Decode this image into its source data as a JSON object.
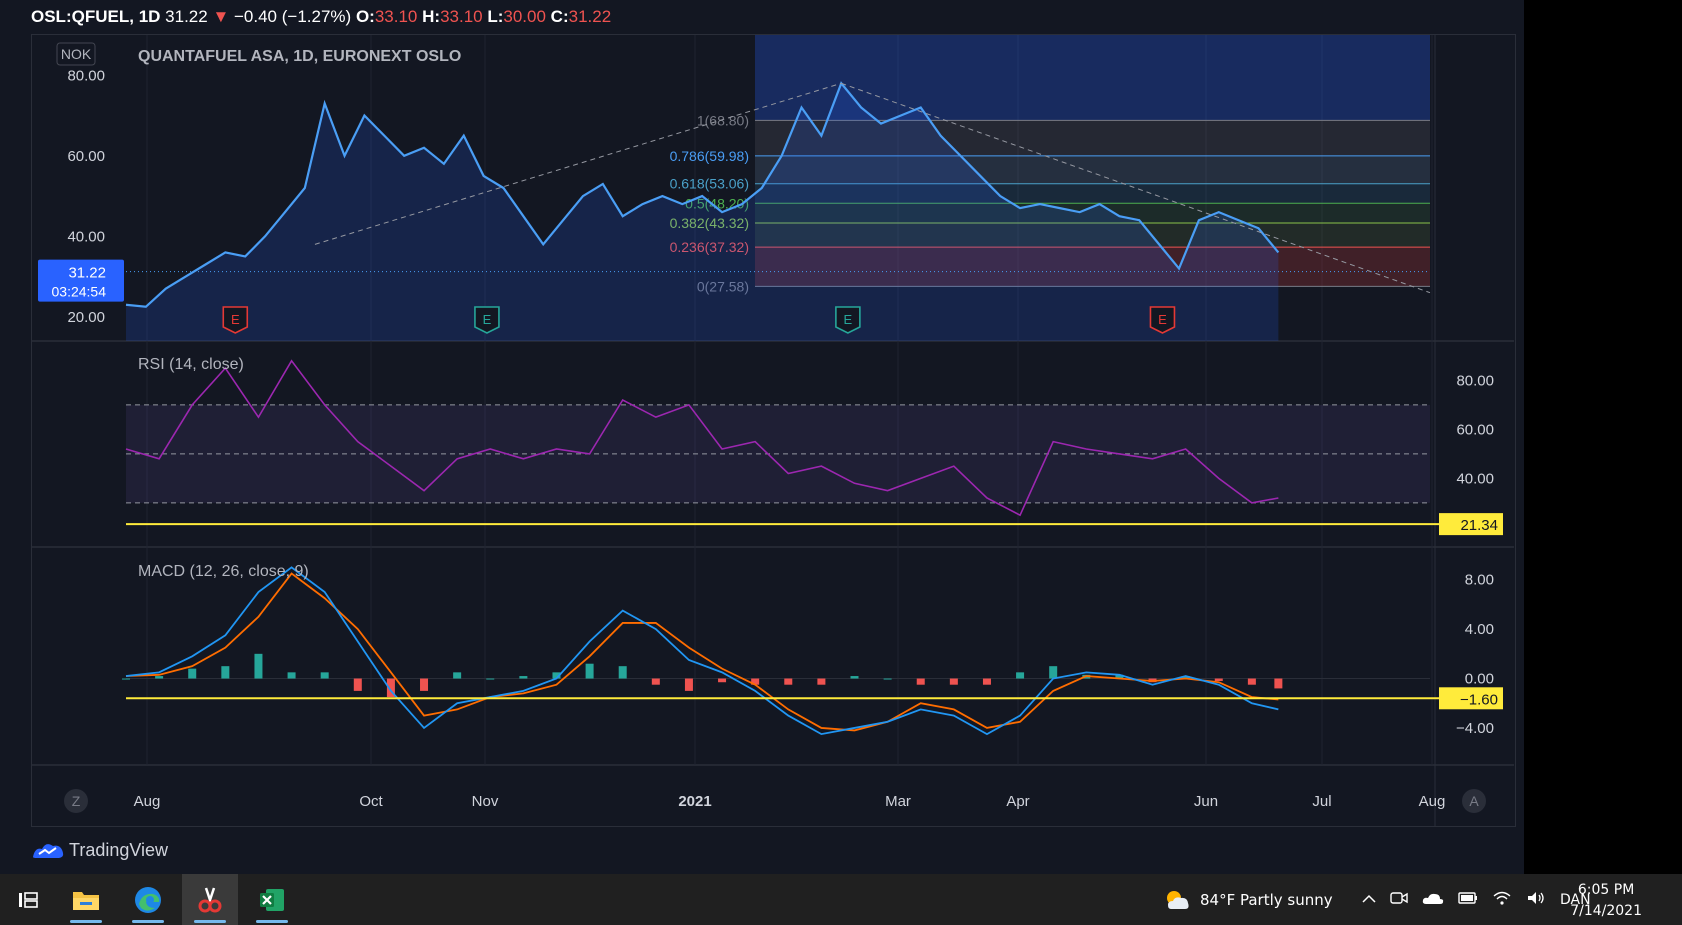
{
  "header": {
    "symbol": "OSL:QFUEL,",
    "interval": "1D",
    "last": "31.22",
    "change_arrow": "▼",
    "change": "−0.40 (−1.27%)",
    "open_label": "O:",
    "open": "33.10",
    "high_label": "H:",
    "high": "33.10",
    "low_label": "L:",
    "low": "30.00",
    "close_label": "C:",
    "close": "31.22"
  },
  "price_pane": {
    "currency": "NOK",
    "title": "QUANTAFUEL ASA, 1D, EURONEXT OSLO",
    "price_tag": "31.22",
    "countdown": "03:24:54"
  },
  "rsi_pane": {
    "title": "RSI (14, close)",
    "marker_label": "21.34"
  },
  "macd_pane": {
    "title": "MACD (12, 26, close, 9)",
    "marker_label": "−1.60"
  },
  "buttons": {
    "left": "Z",
    "right": "A"
  },
  "brand": {
    "name": "TradingView"
  },
  "taskbar": {
    "weather": "84°F  Partly sunny",
    "language": "DAN",
    "time": "6:05 PM",
    "date": "7/14/2021"
  },
  "colors": {
    "price_line": "#4a9ef5",
    "rsi_line": "#9c27b0",
    "macd_line": "#2196f3",
    "signal_line": "#ff6d00",
    "hist_up": "#26a69a",
    "hist_down": "#ef5350",
    "marker": "#ffeb3b",
    "earnings_red": "#e53935",
    "earnings_green": "#26a69a"
  },
  "chart_data": [
    {
      "type": "line",
      "name": "price",
      "x_ticks": [
        "Aug",
        "Oct",
        "Nov",
        "2021",
        "Mar",
        "Apr",
        "Jun",
        "Jul",
        "Aug"
      ],
      "y_ticks": [
        "20.00",
        "40.00",
        "60.00",
        "80.00"
      ],
      "ylim": [
        14,
        90
      ],
      "x": [
        0,
        6,
        12,
        18,
        24,
        30,
        36,
        42,
        48,
        54,
        60,
        66,
        72,
        78,
        84,
        90,
        96,
        102,
        108,
        114,
        120,
        126,
        132,
        138,
        144,
        150,
        156,
        162,
        168,
        174,
        180,
        186,
        192,
        198,
        204,
        210,
        216,
        222,
        228,
        234,
        240,
        246,
        252,
        258,
        264,
        270,
        276,
        282,
        288,
        294,
        300,
        306,
        312,
        318,
        324,
        330,
        336,
        342,
        348
      ],
      "values": [
        23,
        22.5,
        27,
        30,
        33,
        36,
        35,
        40,
        46,
        52,
        73,
        60,
        70,
        65,
        60,
        62,
        58,
        65,
        55,
        52,
        45,
        38,
        44,
        50,
        53,
        45,
        48,
        50,
        48,
        50,
        46,
        48,
        52,
        60,
        72,
        65,
        78,
        72,
        68,
        70,
        72,
        65,
        60,
        55,
        50,
        47,
        48,
        47,
        46,
        48,
        45,
        44,
        38,
        32,
        44,
        46,
        44,
        42,
        36
      ],
      "annotations": {
        "earnings": [
          {
            "x": 33,
            "label": "E",
            "color": "red"
          },
          {
            "x": 109,
            "label": "E",
            "color": "green"
          },
          {
            "x": 218,
            "label": "E",
            "color": "green"
          },
          {
            "x": 313,
            "label": "E",
            "color": "red"
          }
        ],
        "fibonacci": [
          {
            "label": "1(68.80)",
            "value": 68.8
          },
          {
            "label": "0.786(59.98)",
            "value": 59.98
          },
          {
            "label": "0.618(53.06)",
            "value": 53.06
          },
          {
            "label": "0.5(48.20)",
            "value": 48.2
          },
          {
            "label": "0.382(43.32)",
            "value": 43.32
          },
          {
            "label": "0.236(37.32)",
            "value": 37.32
          },
          {
            "label": "0(27.58)",
            "value": 27.58
          }
        ]
      }
    },
    {
      "type": "line",
      "name": "RSI",
      "y_ticks": [
        "40.00",
        "60.00",
        "80.00"
      ],
      "bands": [
        30,
        50,
        70
      ],
      "ylim": [
        12,
        92
      ],
      "x": [
        0,
        10,
        20,
        30,
        40,
        50,
        60,
        70,
        80,
        90,
        100,
        110,
        120,
        130,
        140,
        150,
        160,
        170,
        180,
        190,
        200,
        210,
        220,
        230,
        240,
        250,
        260,
        270,
        280,
        290,
        300,
        310,
        320,
        330,
        340,
        348
      ],
      "values": [
        52,
        48,
        70,
        85,
        65,
        88,
        70,
        55,
        45,
        35,
        48,
        52,
        48,
        52,
        50,
        72,
        65,
        70,
        52,
        55,
        42,
        45,
        38,
        35,
        40,
        45,
        32,
        25,
        55,
        52,
        50,
        48,
        52,
        40,
        30,
        32
      ],
      "marker_value": 21.34
    },
    {
      "type": "line",
      "name": "MACD",
      "y_ticks": [
        "−4.00",
        "0.00",
        "4.00",
        "8.00"
      ],
      "ylim": [
        -7,
        10
      ],
      "x": [
        0,
        10,
        20,
        30,
        40,
        50,
        60,
        70,
        80,
        90,
        100,
        110,
        120,
        130,
        140,
        150,
        160,
        170,
        180,
        190,
        200,
        210,
        220,
        230,
        240,
        250,
        260,
        270,
        280,
        290,
        300,
        310,
        320,
        330,
        340,
        348
      ],
      "series": [
        {
          "name": "MACD",
          "values": [
            0.2,
            0.5,
            1.8,
            3.5,
            7.0,
            9.0,
            7.0,
            3.0,
            -1.0,
            -4.0,
            -2.0,
            -1.5,
            -1.0,
            0.0,
            3.0,
            5.5,
            4.0,
            1.5,
            0.5,
            -1.0,
            -3.0,
            -4.5,
            -4.0,
            -3.5,
            -2.5,
            -3.0,
            -4.5,
            -3.0,
            0.0,
            0.5,
            0.3,
            -0.5,
            0.2,
            -0.5,
            -2.0,
            -2.5
          ]
        },
        {
          "name": "Signal",
          "values": [
            0.2,
            0.3,
            1.0,
            2.5,
            5.0,
            8.5,
            6.5,
            4.0,
            0.5,
            -3.0,
            -2.5,
            -1.5,
            -1.2,
            -0.5,
            1.8,
            4.5,
            4.5,
            2.5,
            0.8,
            -0.5,
            -2.5,
            -4.0,
            -4.2,
            -3.5,
            -2.0,
            -2.5,
            -4.0,
            -3.5,
            -1.0,
            0.2,
            0.0,
            -0.2,
            0.0,
            -0.3,
            -1.5,
            -1.7
          ]
        }
      ],
      "histogram": [
        0.0,
        0.2,
        0.8,
        1.0,
        2.0,
        0.5,
        0.5,
        -1.0,
        -1.5,
        -1.0,
        0.5,
        0.0,
        0.2,
        0.5,
        1.2,
        1.0,
        -0.5,
        -1.0,
        -0.3,
        -0.5,
        -0.5,
        -0.5,
        0.2,
        0.0,
        -0.5,
        -0.5,
        -0.5,
        0.5,
        1.0,
        0.3,
        0.3,
        -0.3,
        0.2,
        -0.2,
        -0.5,
        -0.8
      ],
      "marker_value": -1.6
    }
  ]
}
